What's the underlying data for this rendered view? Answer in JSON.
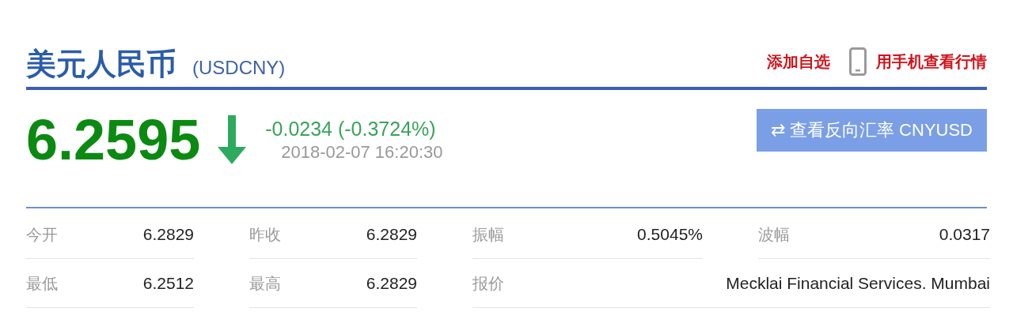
{
  "header": {
    "title": "美元人民币",
    "symbol": "(USDCNY)",
    "add_watchlist": "添加自选",
    "mobile_link": "用手机查看行情"
  },
  "quote": {
    "price": "6.2595",
    "falling": true,
    "change": "-0.0234 (-0.3724%)",
    "time": "2018-02-07 16:20:30",
    "reverse_button": "⇄ 查看反向汇率 CNYUSD"
  },
  "stats": [
    {
      "label": "今开",
      "value": "6.2829"
    },
    {
      "label": "昨收",
      "value": "6.2829"
    },
    {
      "label": "振幅",
      "value": "0.5045%"
    },
    {
      "label": "波幅",
      "value": "0.0317"
    },
    {
      "label": "最低",
      "value": "6.2512"
    },
    {
      "label": "最高",
      "value": "6.2829"
    },
    {
      "label": "报价",
      "value": "Mecklai Financial Services. Mumbai",
      "wide": true
    }
  ]
}
